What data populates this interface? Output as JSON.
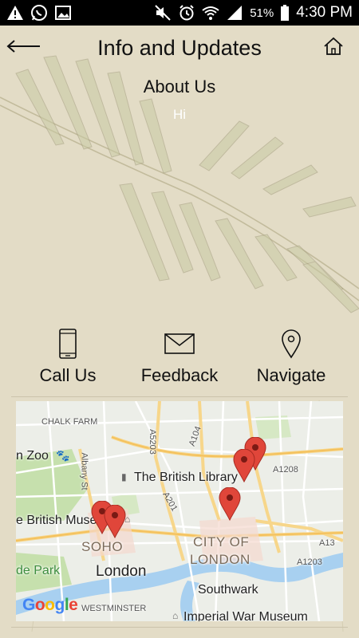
{
  "status_bar": {
    "battery": "51%",
    "time": "4:30 PM",
    "icons": [
      "warning-icon",
      "whatsapp-icon",
      "image-icon",
      "mute-icon",
      "alarm-icon",
      "wifi-icon",
      "signal-icon",
      "battery-icon"
    ]
  },
  "header": {
    "title": "Info and Updates",
    "back_icon": "back-arrow-icon",
    "home_icon": "home-icon"
  },
  "about": {
    "title": "About Us",
    "body": "Hi"
  },
  "actions": [
    {
      "label": "Call Us",
      "icon": "phone-icon"
    },
    {
      "label": "Feedback",
      "icon": "envelope-icon"
    },
    {
      "label": "Navigate",
      "icon": "location-pin-icon"
    }
  ],
  "map": {
    "labels": {
      "chalk_farm": "CHALK FARM",
      "zoo": "n Zoo",
      "albany": "Albany St",
      "a5203": "A5203",
      "a104": "A104",
      "british_library": "The British Library",
      "a1208": "A1208",
      "a201": "A201",
      "british_museum": "e British Museum",
      "soho": "SOHO",
      "city_of_london_1": "CITY OF",
      "city_of_london_2": "LONDON",
      "a13": "A13",
      "park": "de Park",
      "london": "London",
      "a1203": "A1203",
      "southwark": "Southwark",
      "westminster": "WESTMINSTER",
      "imperial": "Imperial War Museum"
    },
    "logo": "Google",
    "colors": {
      "road_major": "#f7d68a",
      "road_minor": "#ffffff",
      "water": "#a8d0f0",
      "park": "#c8e2b0",
      "pin": "#e0463a"
    }
  }
}
